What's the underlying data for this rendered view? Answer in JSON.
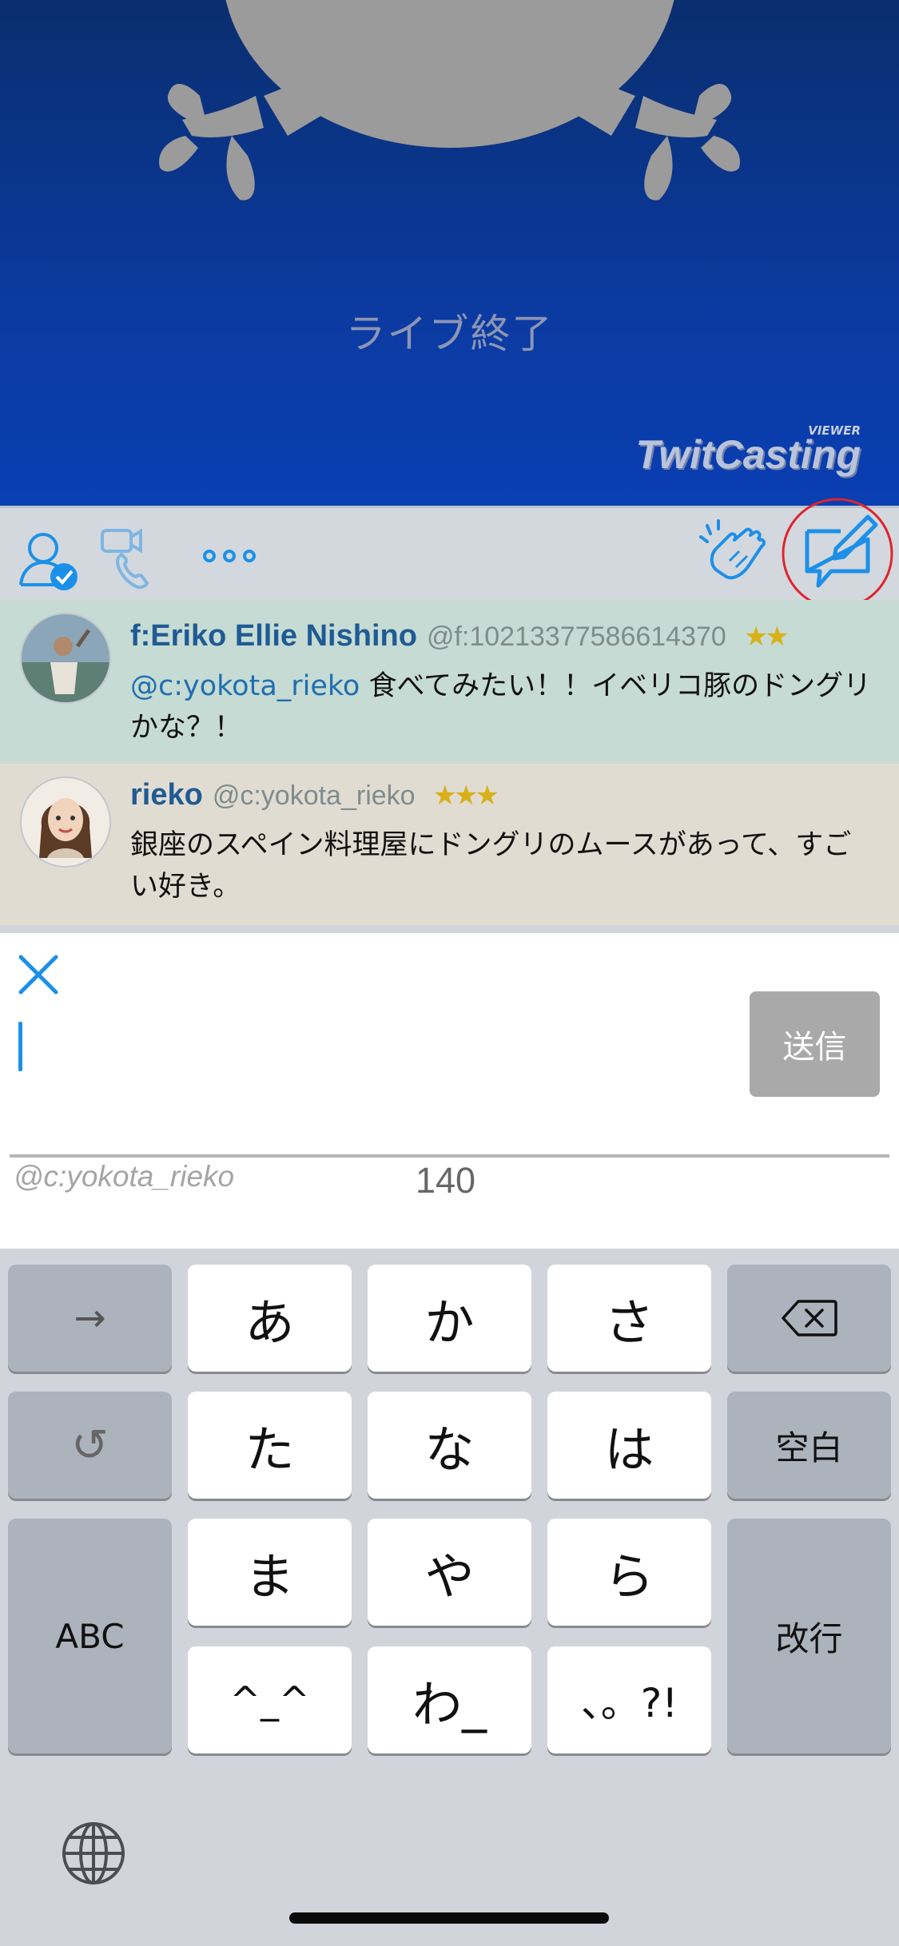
{
  "video": {
    "status_text": "ライブ終了",
    "logo_text": "TwitCasting",
    "logo_sub": "VIEWER"
  },
  "toolbar": {
    "icons": [
      "user-check-icon",
      "video-phone-icon",
      "more-icon",
      "clap-icon",
      "compose-comment-icon"
    ]
  },
  "comments": [
    {
      "name": "f:Eriko Ellie Nishino",
      "handle": "@f:10213377586614370",
      "stars": "★★",
      "mention": "@c:yokota_rieko",
      "text": " 食べてみたい！！イベリコ豚のドングリかな？！"
    },
    {
      "name": "rieko",
      "handle": "@c:yokota_rieko",
      "stars": "★★★",
      "text": "銀座のスペイン料理屋にドングリのムースがあって、すごい好き。"
    }
  ],
  "compose": {
    "send_label": "送信",
    "reply_handle": "@c:yokota_rieko",
    "char_count": "140"
  },
  "keyboard": {
    "arrow": "→",
    "undo": "↺",
    "abc": "ABC",
    "space": "空白",
    "return": "改行",
    "keys": [
      "あ",
      "か",
      "さ",
      "た",
      "な",
      "は",
      "ま",
      "や",
      "ら",
      "^_^",
      "わ_",
      "、。?!"
    ]
  },
  "colors": {
    "accent": "#1c90e8",
    "highlight_circle": "#e0232e",
    "comment_1_bg": "#c6dbd3",
    "comment_2_bg": "#e1dcd2"
  }
}
